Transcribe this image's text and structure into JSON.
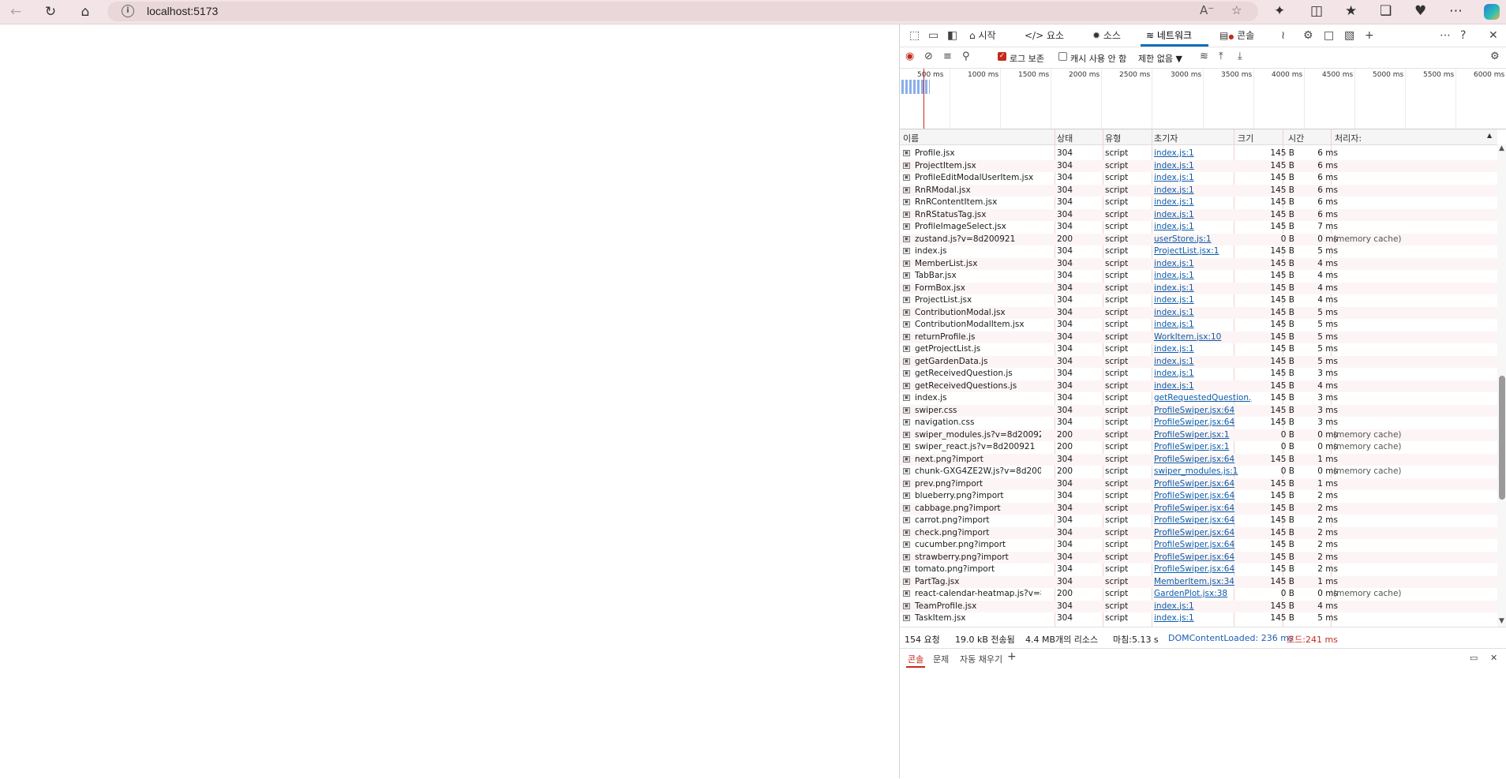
{
  "browser": {
    "url": "localhost:5173",
    "icons": [
      "back-icon",
      "reload-icon",
      "home-icon",
      "info-icon",
      "read-aloud-icon",
      "favorite-star-icon",
      "extensions-icon",
      "split-screen-icon",
      "favorites-icon",
      "collections-icon",
      "browser-essentials-icon",
      "more-icon",
      "copilot-icon"
    ]
  },
  "devtools": {
    "tabs": [
      {
        "label": "시작",
        "icon": "home-icon"
      },
      {
        "label": "요소",
        "icon": "code-icon"
      },
      {
        "label": "소스",
        "icon": "bug-icon"
      },
      {
        "label": "네트워크",
        "icon": "wifi-icon",
        "active": true
      },
      {
        "label": "콘솔",
        "icon": "console-icon"
      }
    ],
    "toolbar": {
      "preserve_log_label": "로그 보존",
      "preserve_log_checked": true,
      "disable_cache_label": "캐시 사용 안 함",
      "disable_cache_checked": false,
      "throttle_label": "제한 없음"
    },
    "timeline_ticks": [
      "500 ms",
      "1000 ms",
      "1500 ms",
      "2000 ms",
      "2500 ms",
      "3000 ms",
      "3500 ms",
      "4000 ms",
      "4500 ms",
      "5000 ms",
      "5500 ms",
      "6000 ms"
    ],
    "columns": {
      "name": "이름",
      "status": "상태",
      "type": "유형",
      "initiator": "초기자",
      "size": "크기",
      "time": "시간",
      "processor": "처리자:"
    },
    "rows": [
      {
        "name": "Profile.jsx",
        "status": "304",
        "type": "script",
        "initiator": "index.js:1",
        "size": "145 B",
        "time": "6 ms",
        "proc": ""
      },
      {
        "name": "ProjectItem.jsx",
        "status": "304",
        "type": "script",
        "initiator": "index.js:1",
        "size": "145 B",
        "time": "6 ms",
        "proc": ""
      },
      {
        "name": "ProfileEditModalUserItem.jsx",
        "status": "304",
        "type": "script",
        "initiator": "index.js:1",
        "size": "145 B",
        "time": "6 ms",
        "proc": ""
      },
      {
        "name": "RnRModal.jsx",
        "status": "304",
        "type": "script",
        "initiator": "index.js:1",
        "size": "145 B",
        "time": "6 ms",
        "proc": ""
      },
      {
        "name": "RnRContentItem.jsx",
        "status": "304",
        "type": "script",
        "initiator": "index.js:1",
        "size": "145 B",
        "time": "6 ms",
        "proc": ""
      },
      {
        "name": "RnRStatusTag.jsx",
        "status": "304",
        "type": "script",
        "initiator": "index.js:1",
        "size": "145 B",
        "time": "6 ms",
        "proc": ""
      },
      {
        "name": "ProfileImageSelect.jsx",
        "status": "304",
        "type": "script",
        "initiator": "index.js:1",
        "size": "145 B",
        "time": "7 ms",
        "proc": ""
      },
      {
        "name": "zustand.js?v=8d200921",
        "status": "200",
        "type": "script",
        "initiator": "userStore.js:1",
        "size": "0 B",
        "time": "0 ms",
        "proc": "(memory cache)"
      },
      {
        "name": "index.js",
        "status": "304",
        "type": "script",
        "initiator": "ProjectList.jsx:1",
        "size": "145 B",
        "time": "5 ms",
        "proc": ""
      },
      {
        "name": "MemberList.jsx",
        "status": "304",
        "type": "script",
        "initiator": "index.js:1",
        "size": "145 B",
        "time": "4 ms",
        "proc": ""
      },
      {
        "name": "TabBar.jsx",
        "status": "304",
        "type": "script",
        "initiator": "index.js:1",
        "size": "145 B",
        "time": "4 ms",
        "proc": ""
      },
      {
        "name": "FormBox.jsx",
        "status": "304",
        "type": "script",
        "initiator": "index.js:1",
        "size": "145 B",
        "time": "4 ms",
        "proc": ""
      },
      {
        "name": "ProjectList.jsx",
        "status": "304",
        "type": "script",
        "initiator": "index.js:1",
        "size": "145 B",
        "time": "4 ms",
        "proc": ""
      },
      {
        "name": "ContributionModal.jsx",
        "status": "304",
        "type": "script",
        "initiator": "index.js:1",
        "size": "145 B",
        "time": "5 ms",
        "proc": ""
      },
      {
        "name": "ContributionModalItem.jsx",
        "status": "304",
        "type": "script",
        "initiator": "index.js:1",
        "size": "145 B",
        "time": "5 ms",
        "proc": ""
      },
      {
        "name": "returnProfile.js",
        "status": "304",
        "type": "script",
        "initiator": "WorkItem.jsx:10",
        "size": "145 B",
        "time": "5 ms",
        "proc": ""
      },
      {
        "name": "getProjectList.js",
        "status": "304",
        "type": "script",
        "initiator": "index.js:1",
        "size": "145 B",
        "time": "5 ms",
        "proc": ""
      },
      {
        "name": "getGardenData.js",
        "status": "304",
        "type": "script",
        "initiator": "index.js:1",
        "size": "145 B",
        "time": "5 ms",
        "proc": ""
      },
      {
        "name": "getReceivedQuestion.js",
        "status": "304",
        "type": "script",
        "initiator": "index.js:1",
        "size": "145 B",
        "time": "3 ms",
        "proc": ""
      },
      {
        "name": "getReceivedQuestions.js",
        "status": "304",
        "type": "script",
        "initiator": "index.js:1",
        "size": "145 B",
        "time": "4 ms",
        "proc": ""
      },
      {
        "name": "index.js",
        "status": "304",
        "type": "script",
        "initiator": "getRequestedQuestion.js:",
        "size": "145 B",
        "time": "3 ms",
        "proc": ""
      },
      {
        "name": "swiper.css",
        "status": "304",
        "type": "script",
        "initiator": "ProfileSwiper.jsx:64",
        "size": "145 B",
        "time": "3 ms",
        "proc": ""
      },
      {
        "name": "navigation.css",
        "status": "304",
        "type": "script",
        "initiator": "ProfileSwiper.jsx:64",
        "size": "145 B",
        "time": "3 ms",
        "proc": ""
      },
      {
        "name": "swiper_modules.js?v=8d200921",
        "status": "200",
        "type": "script",
        "initiator": "ProfileSwiper.jsx:1",
        "size": "0 B",
        "time": "0 ms",
        "proc": "(memory cache)"
      },
      {
        "name": "swiper_react.js?v=8d200921",
        "status": "200",
        "type": "script",
        "initiator": "ProfileSwiper.jsx:1",
        "size": "0 B",
        "time": "0 ms",
        "proc": "(memory cache)"
      },
      {
        "name": "next.png?import",
        "status": "304",
        "type": "script",
        "initiator": "ProfileSwiper.jsx:64",
        "size": "145 B",
        "time": "1 ms",
        "proc": ""
      },
      {
        "name": "chunk-GXG4ZE2W.js?v=8d200921",
        "status": "200",
        "type": "script",
        "initiator": "swiper_modules.js:1",
        "size": "0 B",
        "time": "0 ms",
        "proc": "(memory cache)"
      },
      {
        "name": "prev.png?import",
        "status": "304",
        "type": "script",
        "initiator": "ProfileSwiper.jsx:64",
        "size": "145 B",
        "time": "1 ms",
        "proc": ""
      },
      {
        "name": "blueberry.png?import",
        "status": "304",
        "type": "script",
        "initiator": "ProfileSwiper.jsx:64",
        "size": "145 B",
        "time": "2 ms",
        "proc": ""
      },
      {
        "name": "cabbage.png?import",
        "status": "304",
        "type": "script",
        "initiator": "ProfileSwiper.jsx:64",
        "size": "145 B",
        "time": "2 ms",
        "proc": ""
      },
      {
        "name": "carrot.png?import",
        "status": "304",
        "type": "script",
        "initiator": "ProfileSwiper.jsx:64",
        "size": "145 B",
        "time": "2 ms",
        "proc": ""
      },
      {
        "name": "check.png?import",
        "status": "304",
        "type": "script",
        "initiator": "ProfileSwiper.jsx:64",
        "size": "145 B",
        "time": "2 ms",
        "proc": ""
      },
      {
        "name": "cucumber.png?import",
        "status": "304",
        "type": "script",
        "initiator": "ProfileSwiper.jsx:64",
        "size": "145 B",
        "time": "2 ms",
        "proc": ""
      },
      {
        "name": "strawberry.png?import",
        "status": "304",
        "type": "script",
        "initiator": "ProfileSwiper.jsx:64",
        "size": "145 B",
        "time": "2 ms",
        "proc": ""
      },
      {
        "name": "tomato.png?import",
        "status": "304",
        "type": "script",
        "initiator": "ProfileSwiper.jsx:64",
        "size": "145 B",
        "time": "2 ms",
        "proc": ""
      },
      {
        "name": "PartTag.jsx",
        "status": "304",
        "type": "script",
        "initiator": "MemberItem.jsx:34",
        "size": "145 B",
        "time": "1 ms",
        "proc": ""
      },
      {
        "name": "react-calendar-heatmap.js?v=8d200921",
        "status": "200",
        "type": "script",
        "initiator": "GardenPlot.jsx:38",
        "size": "0 B",
        "time": "0 ms",
        "proc": "(memory cache)"
      },
      {
        "name": "TeamProfile.jsx",
        "status": "304",
        "type": "script",
        "initiator": "index.js:1",
        "size": "145 B",
        "time": "4 ms",
        "proc": ""
      },
      {
        "name": "TaskItem.jsx",
        "status": "304",
        "type": "script",
        "initiator": "index.js:1",
        "size": "145 B",
        "time": "5 ms",
        "proc": ""
      }
    ],
    "summary": {
      "requests": "154 요청",
      "transferred": "19.0 kB 전송됨",
      "resources": "4.4 MB개의 리소스",
      "finish": "마침:5.13 s",
      "dcl": "DOMContentLoaded: 236 ms",
      "load": "로드:241 ms"
    },
    "drawer_tabs": [
      "콘솔",
      "문제",
      "자동 채우기"
    ],
    "colors": {
      "accent": "#0f6cbd",
      "record": "#c42b1c",
      "dcl": "#1a5fb4",
      "load": "#c42b1c"
    }
  }
}
